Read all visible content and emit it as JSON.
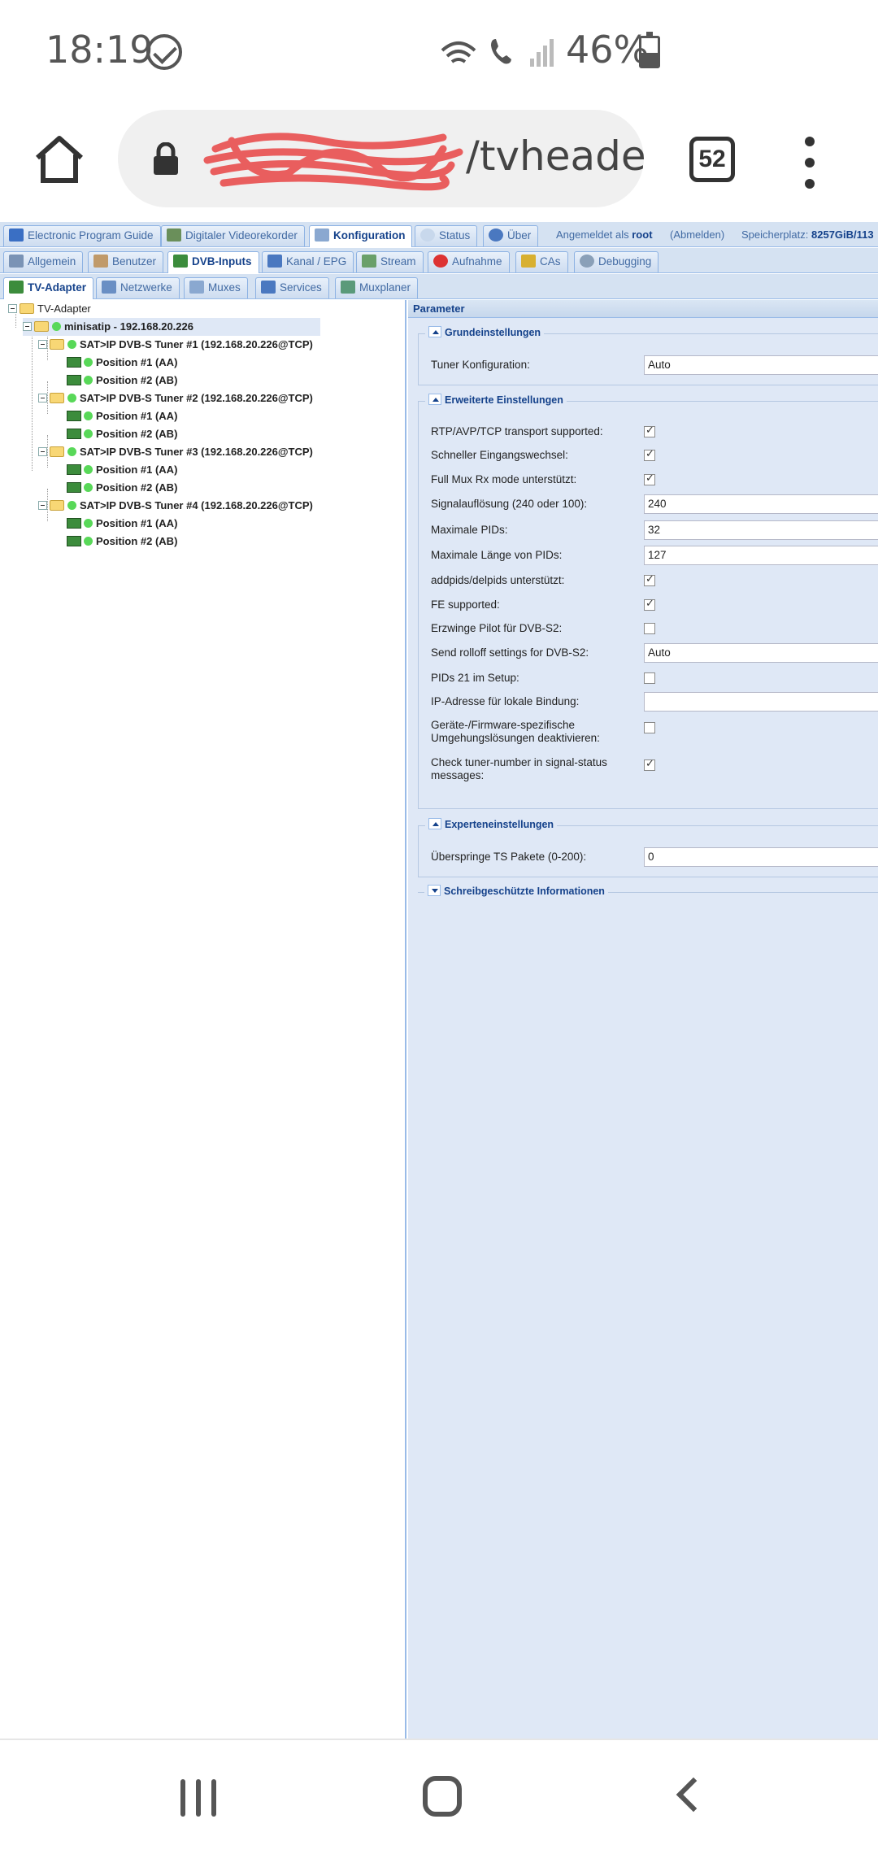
{
  "status_bar": {
    "time": "18:19",
    "battery": "46%",
    "battery_level": 0.46
  },
  "browser": {
    "url_visible": "/tvheade",
    "tab_count": "52"
  },
  "nav_tabs": [
    {
      "label": "Electronic Program Guide",
      "icon": "epg-icon"
    },
    {
      "label": "Digitaler Videorekorder",
      "icon": "dvr-icon"
    },
    {
      "label": "Konfiguration",
      "icon": "wrench-icon"
    },
    {
      "label": "Status",
      "icon": "eye-icon"
    },
    {
      "label": "Über",
      "icon": "info-icon"
    }
  ],
  "login": {
    "prefix": "Angemeldet als",
    "user": "root",
    "logout": "(Abmelden)",
    "storage_label": "Speicherplatz:",
    "storage_value": "8257GiB/113"
  },
  "config_tabs": [
    {
      "label": "Allgemein",
      "icon": "tools-icon"
    },
    {
      "label": "Benutzer",
      "icon": "users-icon"
    },
    {
      "label": "DVB-Inputs",
      "icon": "tv-card-icon"
    },
    {
      "label": "Kanal / EPG",
      "icon": "tv-icon"
    },
    {
      "label": "Stream",
      "icon": "stream-icon"
    },
    {
      "label": "Aufnahme",
      "icon": "record-icon"
    },
    {
      "label": "CAs",
      "icon": "key-icon"
    },
    {
      "label": "Debugging",
      "icon": "bug-icon"
    }
  ],
  "dvb_tabs": [
    {
      "label": "TV-Adapter",
      "icon": "tv-card-icon"
    },
    {
      "label": "Netzwerke",
      "icon": "antenna-icon"
    },
    {
      "label": "Muxes",
      "icon": "mux-icon"
    },
    {
      "label": "Services",
      "icon": "services-icon"
    },
    {
      "label": "Muxplaner",
      "icon": "muxplaner-icon"
    }
  ],
  "tree": {
    "root": "TV-Adapter",
    "device": "minisatip - 192.168.20.226",
    "tuners": [
      {
        "name": "SAT>IP DVB-S Tuner #1 (192.168.20.226@TCP)",
        "positions": [
          "Position #1 (AA)",
          "Position #2 (AB)"
        ]
      },
      {
        "name": "SAT>IP DVB-S Tuner #2 (192.168.20.226@TCP)",
        "positions": [
          "Position #1 (AA)",
          "Position #2 (AB)"
        ]
      },
      {
        "name": "SAT>IP DVB-S Tuner #3 (192.168.20.226@TCP)",
        "positions": [
          "Position #1 (AA)",
          "Position #2 (AB)"
        ]
      },
      {
        "name": "SAT>IP DVB-S Tuner #4 (192.168.20.226@TCP)",
        "positions": [
          "Position #1 (AA)",
          "Position #2 (AB)"
        ]
      }
    ]
  },
  "params": {
    "title": "Parameter",
    "basic": {
      "legend": "Grundeinstellungen",
      "tuner_config_label": "Tuner Konfiguration:",
      "tuner_config_value": "Auto"
    },
    "advanced": {
      "legend": "Erweiterte Einstellungen",
      "rows": [
        {
          "label": "RTP/AVP/TCP transport supported:",
          "type": "checkbox",
          "checked": true
        },
        {
          "label": "Schneller Eingangswechsel:",
          "type": "checkbox",
          "checked": true
        },
        {
          "label": "Full Mux Rx mode unterstützt:",
          "type": "checkbox",
          "checked": true
        },
        {
          "label": "Signalauflösung (240 oder 100):",
          "type": "text",
          "value": "240"
        },
        {
          "label": "Maximale PIDs:",
          "type": "text",
          "value": "32"
        },
        {
          "label": "Maximale Länge von PIDs:",
          "type": "text",
          "value": "127"
        },
        {
          "label": "addpids/delpids unterstützt:",
          "type": "checkbox",
          "checked": true
        },
        {
          "label": "FE supported:",
          "type": "checkbox",
          "checked": true
        },
        {
          "label": "Erzwinge Pilot für DVB-S2:",
          "type": "checkbox",
          "checked": false
        },
        {
          "label": "Send rolloff settings for DVB-S2:",
          "type": "text",
          "value": "Auto"
        },
        {
          "label": "PIDs 21 im Setup:",
          "type": "checkbox",
          "checked": false
        },
        {
          "label": "IP-Adresse für lokale Bindung:",
          "type": "text",
          "value": ""
        },
        {
          "label": "Geräte-/Firmware-spezifische Umgehungslösungen deaktivieren:",
          "type": "checkbox",
          "checked": false
        },
        {
          "label": "Check tuner-number in signal-status messages:",
          "type": "checkbox",
          "checked": true
        }
      ]
    },
    "expert": {
      "legend": "Experteneinstellungen",
      "skip_label": "Überspringe TS Pakete (0-200):",
      "skip_value": "0"
    },
    "readonly": {
      "legend": "Schreibgeschützte Informationen"
    }
  },
  "colors": {
    "tab_bg": "#d5e2f2",
    "panel_bg": "#dfe8f6",
    "accent": "#15428b",
    "status_ok": "#58d858"
  }
}
